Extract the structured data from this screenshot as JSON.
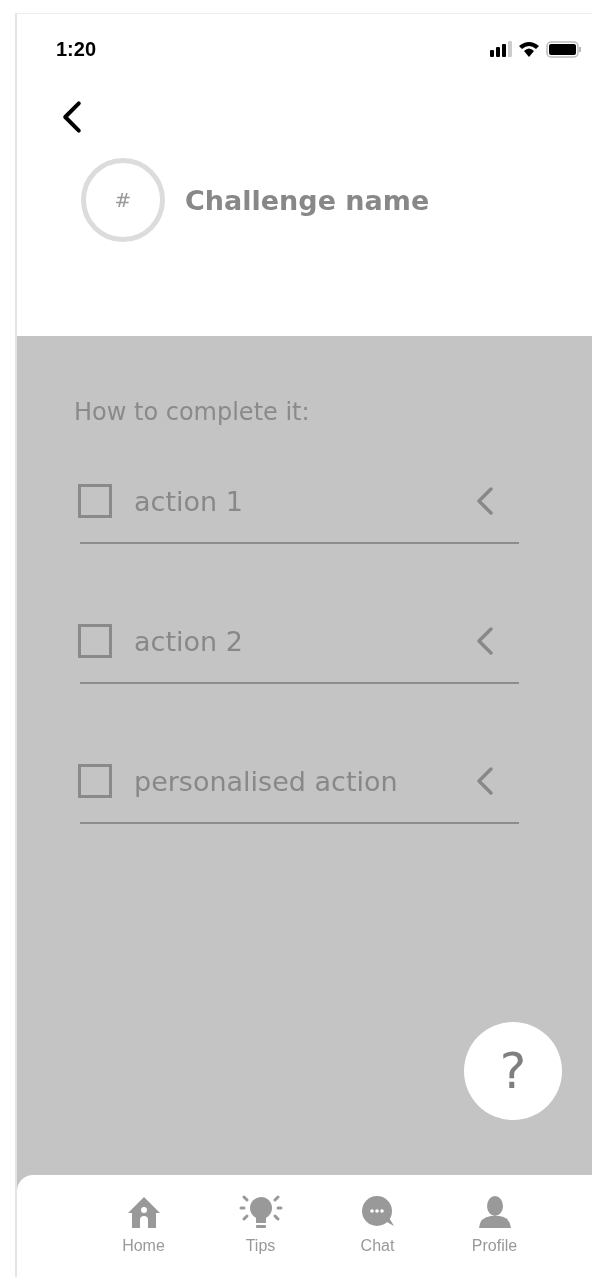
{
  "status_bar": {
    "time": "1:20"
  },
  "challenge": {
    "badge": "#",
    "title": "Challenge name"
  },
  "instructions": {
    "heading": "How to complete it:",
    "actions": [
      {
        "label": "action 1",
        "checked": false
      },
      {
        "label": "action 2",
        "checked": false
      },
      {
        "label": "personalised action",
        "checked": false
      }
    ]
  },
  "help_button": {
    "label": "?"
  },
  "nav": [
    {
      "kind": "home",
      "label": "Home"
    },
    {
      "kind": "tips",
      "label": "Tips"
    },
    {
      "kind": "chat",
      "label": "Chat"
    },
    {
      "kind": "profile",
      "label": "Profile"
    }
  ]
}
